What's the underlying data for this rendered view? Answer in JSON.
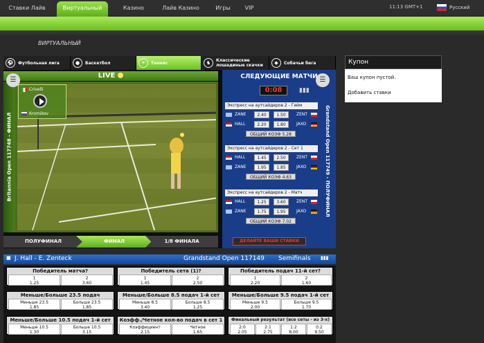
{
  "nav": {
    "items": [
      {
        "label": "Ставки Лайв"
      },
      {
        "label": "Виртуальный"
      },
      {
        "label": "Казино"
      },
      {
        "label": "Лайв Казино"
      },
      {
        "label": "Игры"
      },
      {
        "label": "VIP"
      }
    ],
    "time": "11:13 GMT+1",
    "language": "Русский"
  },
  "page_title": "ВИРТУАЛЬНЫЙ",
  "sport_tabs": [
    {
      "label": "Футбольная лига",
      "icon": "soccer-ball-icon"
    },
    {
      "label": "Баскетбол",
      "icon": "basketball-icon"
    },
    {
      "label": "Теннис",
      "icon": "tennis-icon"
    },
    {
      "label": "Классические\nлошадиные скачки",
      "icon": "horse-icon"
    },
    {
      "label": "Собачьи бега",
      "icon": "greyhound-icon"
    }
  ],
  "live_label": "LIVE",
  "left_vertical_title": "Britannia Open 117748 - ФИНАЛ",
  "score": {
    "player1": "Crivelli",
    "player2": "Kromikov"
  },
  "rounds": [
    "ПОЛУФИНАЛ",
    "ФИНАЛ",
    "1/8 ФИНАЛА"
  ],
  "next": {
    "header": "СЛЕДУЮЩИЕ МАТЧИ",
    "timer": "0:08",
    "right_vertical_title": "Grandstand Open 117749 - ПОЛУФИНАЛ",
    "blocks": [
      {
        "title": "Экспресс на аутсайдеров 2 - Гейм",
        "rows": [
          {
            "p1": "ZANE",
            "o1": "2.40",
            "o2": "1.50",
            "p2": "ZENT"
          },
          {
            "p1": "HALL",
            "o1": "2.20",
            "o2": "1.80",
            "p2": "JAXO"
          }
        ],
        "total": "ОБЩИЙ КОЭФ 5.28"
      },
      {
        "title": "Экспресс на аутсайдеров 2 - Сет 1",
        "rows": [
          {
            "p1": "HALL",
            "o1": "1.45",
            "o2": "2.50",
            "p2": "ZENT"
          },
          {
            "p1": "ZANE",
            "o1": "1.95",
            "o2": "1.85",
            "p2": "JAXO"
          }
        ],
        "total": "ОБЩИЙ КОЭФ 4.63"
      },
      {
        "title": "Экспресс на аутсайдеров 2 - Матч",
        "rows": [
          {
            "p1": "HALL",
            "o1": "1.25",
            "o2": "3.60",
            "p2": "ZENT"
          },
          {
            "p1": "ZANE",
            "o1": "1.75",
            "o2": "1.95",
            "p2": "JAXO"
          }
        ],
        "total": "ОБЩИЙ КОЭФ 7.02"
      }
    ],
    "bet_button": "ДЕЛАЙТЕ ВАШИ СТАВКИ"
  },
  "match": {
    "title": "J. Hall - E. Zenteck",
    "event": "Grandstand Open 117149",
    "round": "Semifinals"
  },
  "markets": [
    {
      "header": "Победитель матча?",
      "cells": [
        [
          "1",
          "1.25"
        ],
        [
          "2",
          "3.60"
        ]
      ]
    },
    {
      "header": "Победитель сета (1)?",
      "cells": [
        [
          "1",
          "1.45"
        ],
        [
          "2",
          "2.50"
        ]
      ]
    },
    {
      "header": "Победитель подач 11-й сет?",
      "cells": [
        [
          "1",
          "2.20"
        ],
        [
          "2",
          "1.60"
        ]
      ]
    },
    {
      "header": "Меньше/Больше 23.5 подач",
      "cells": [
        [
          "Меньше 23.5",
          "1.85"
        ],
        [
          "Больше 23.5",
          "1.85"
        ]
      ]
    },
    {
      "header": "Меньше/Больше 8.5 подач 1-й сет",
      "cells": [
        [
          "Меньше 8.5",
          "3.40"
        ],
        [
          "Больше 8.5",
          "1.25"
        ]
      ]
    },
    {
      "header": "Меньше/Больше 9.5 подач 1-й сет",
      "cells": [
        [
          "Меньше 9.5",
          "2.00"
        ],
        [
          "Больше 9.5",
          "1.70"
        ]
      ]
    },
    {
      "header": "Меньше/Больше 10.5 подач 1-й сет",
      "cells": [
        [
          "Меньше 10.5",
          "1.30"
        ],
        [
          "Больше 10.5",
          "3.15"
        ]
      ]
    },
    {
      "header": "Коэфф./Четное кол-во подач в сет 1",
      "cells": [
        [
          "Коэффициент",
          "2.15"
        ],
        [
          "Четное",
          "1.65"
        ]
      ]
    },
    {
      "header": "Финальный результат (все сеты - из 3-х)",
      "cells": [
        [
          "2:0",
          "2.05"
        ],
        [
          "2:1",
          "2.75"
        ],
        [
          "1:2",
          "8.00"
        ],
        [
          "0:2",
          "9.50"
        ]
      ]
    }
  ],
  "coupon": {
    "header": "Купон",
    "empty": "Ваш купон пустой.",
    "add": "Добавить ставки"
  }
}
